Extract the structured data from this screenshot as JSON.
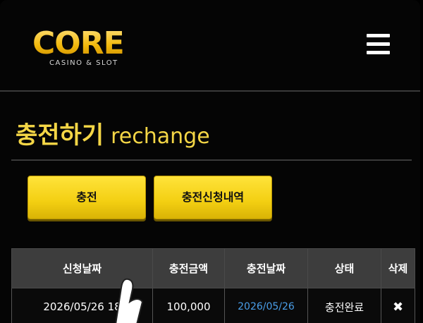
{
  "header": {
    "logo_text": "CORE",
    "logo_subtext": "CASINO & SLOT",
    "menu_icon": "hamburger-menu-icon"
  },
  "page": {
    "title_ko": "충전하기",
    "title_en": "rechange"
  },
  "tabs": [
    {
      "label": "충전"
    },
    {
      "label": "충전신청내역"
    }
  ],
  "table": {
    "columns": [
      "신청날짜",
      "충전금액",
      "충전날짜",
      "상태",
      "삭제"
    ],
    "rows": [
      {
        "request_date": "2026/05/26 18",
        "amount": "100,000",
        "charge_date": "2026/05/26",
        "status": "충전완료",
        "delete_icon": "close-x-icon"
      }
    ]
  },
  "colors": {
    "accent_yellow": "#f3cf12",
    "title_yellow": "#f4d646",
    "link_blue": "#4a9ee8",
    "header_cell": "#3d3d3d"
  }
}
